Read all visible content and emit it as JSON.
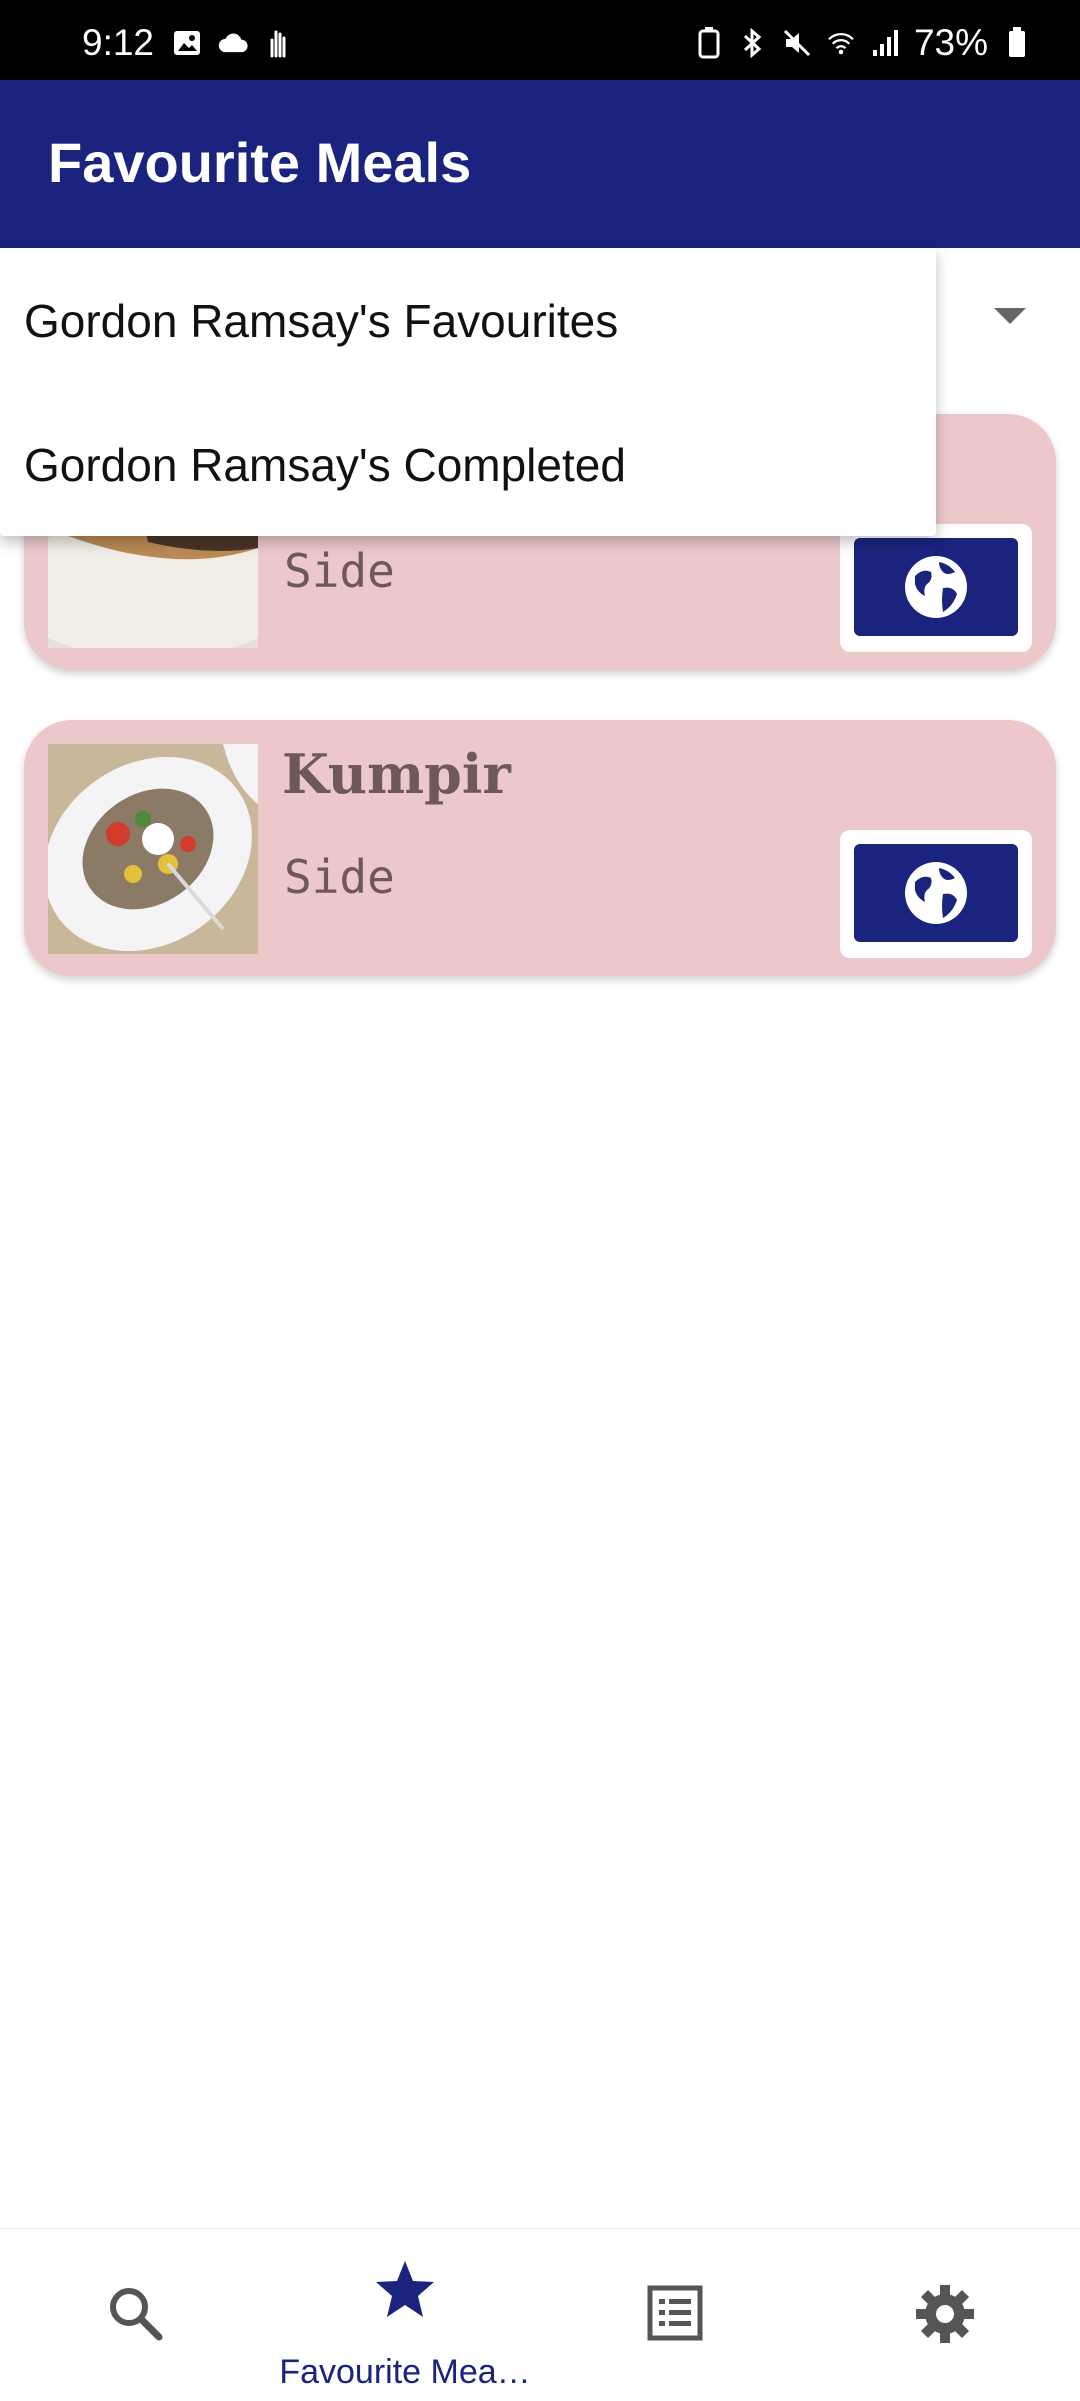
{
  "status_bar": {
    "time": "9:12",
    "battery_percent": "73%",
    "left_icons": [
      "image-icon",
      "cloud-icon",
      "gesture-icon"
    ],
    "right_icons": [
      "battery-saver-icon",
      "bluetooth-icon",
      "mute-icon",
      "wifi-icon",
      "signal-icon",
      "battery-icon"
    ]
  },
  "app_bar": {
    "title": "Favourite Meals"
  },
  "dropdown": {
    "options": [
      "Gordon Ramsay's Favourites",
      "Gordon Ramsay's Completed"
    ]
  },
  "meals": [
    {
      "name": "",
      "category": "Side",
      "image_desc": "pie-image"
    },
    {
      "name": "Kumpir",
      "category": "Side",
      "image_desc": "kumpir-image"
    }
  ],
  "bottom_nav": {
    "items": [
      {
        "icon": "search-icon",
        "label": ""
      },
      {
        "icon": "star-icon",
        "label": "Favourite Mea…"
      },
      {
        "icon": "list-icon",
        "label": ""
      },
      {
        "icon": "gear-icon",
        "label": ""
      }
    ],
    "selected_index": 1
  },
  "colors": {
    "primary": "#1a237e",
    "card_bg": "#ecc8cb",
    "card_text": "#6d5959",
    "status_bar": "#000000"
  }
}
